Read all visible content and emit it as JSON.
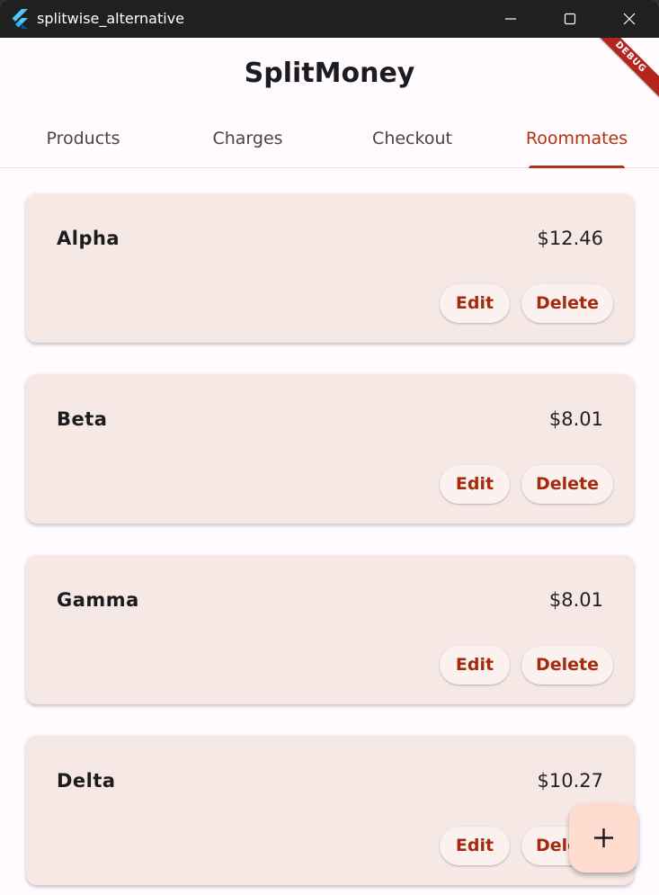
{
  "window": {
    "title": "splitwise_alternative"
  },
  "app": {
    "title": "SplitMoney",
    "debug_label": "DEBUG"
  },
  "tabs": [
    {
      "label": "Products"
    },
    {
      "label": "Charges"
    },
    {
      "label": "Checkout"
    },
    {
      "label": "Roommates"
    }
  ],
  "active_tab": "Roommates",
  "roommates": [
    {
      "name": "Alpha",
      "amount": "$12.46",
      "edit_label": "Edit",
      "delete_label": "Delete"
    },
    {
      "name": "Beta",
      "amount": "$8.01",
      "edit_label": "Edit",
      "delete_label": "Delete"
    },
    {
      "name": "Gamma",
      "amount": "$8.01",
      "edit_label": "Edit",
      "delete_label": "Delete"
    },
    {
      "name": "Delta",
      "amount": "$10.27",
      "edit_label": "Edit",
      "delete_label": "Delete"
    }
  ],
  "fab": {
    "icon": "plus-icon"
  },
  "colors": {
    "accent": "#b3320f",
    "card_bg": "#f5e8e5",
    "fab_bg": "#ffdbd0",
    "titlebar_bg": "#202020"
  }
}
